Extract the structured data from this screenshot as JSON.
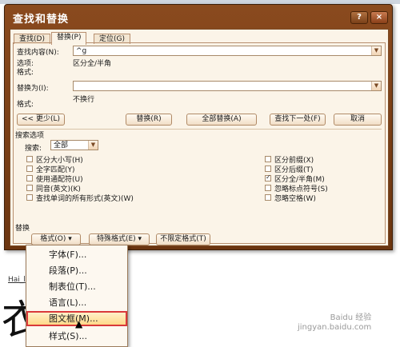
{
  "dialog": {
    "title": "查找和替换",
    "help_btn": "?",
    "close_btn": "×",
    "tabs": [
      {
        "label": "查找(D)"
      },
      {
        "label": "替换(P)"
      },
      {
        "label": "定位(G)"
      }
    ],
    "find_label": "查找内容(N):",
    "find_value": "^g",
    "options_label": "选项:",
    "options_value": "区分全/半角",
    "format_label1": "格式:",
    "replace_label": "替换为(I):",
    "replace_value": "",
    "format_label2": "格式:",
    "format_value2": "不换行",
    "buttons": {
      "less": "<< 更少(L)",
      "replace": "替换(R)",
      "replace_all": "全部替换(A)",
      "find_next": "查找下一处(F)",
      "cancel": "取消"
    },
    "search_options_label": "搜索选项",
    "search_label": "搜索:",
    "search_value": "全部",
    "checkboxes_left": [
      {
        "label": "区分大小写(H)",
        "checked": false
      },
      {
        "label": "全字匹配(Y)",
        "checked": false
      },
      {
        "label": "使用通配符(U)",
        "checked": false
      },
      {
        "label": "同音(英文)(K)",
        "checked": false
      },
      {
        "label": "查找单词的所有形式(英文)(W)",
        "checked": false
      }
    ],
    "checkboxes_right": [
      {
        "label": "区分前缀(X)",
        "checked": false
      },
      {
        "label": "区分后缀(T)",
        "checked": false
      },
      {
        "label": "区分全/半角(M)",
        "checked": true
      },
      {
        "label": "忽略标点符号(S)",
        "checked": false
      },
      {
        "label": "忽略空格(W)",
        "checked": false
      }
    ],
    "replace_section_label": "替换",
    "format_btn": "格式(O) ▾",
    "special_btn": "特殊格式(E) ▾",
    "no_format_btn": "不限定格式(T)"
  },
  "menu": {
    "items": [
      {
        "label": "字体(F)..."
      },
      {
        "label": "段落(P)..."
      },
      {
        "label": "制表位(T)..."
      },
      {
        "label": "语言(L)..."
      },
      {
        "label": "图文框(M)..."
      },
      {
        "label": "样式(S)..."
      }
    ]
  },
  "document": {
    "text": "Hai_l",
    "glyph1": "衣",
    "glyph2": "衣"
  },
  "watermark": "Baidu 经验\njingyan.baidu.com"
}
